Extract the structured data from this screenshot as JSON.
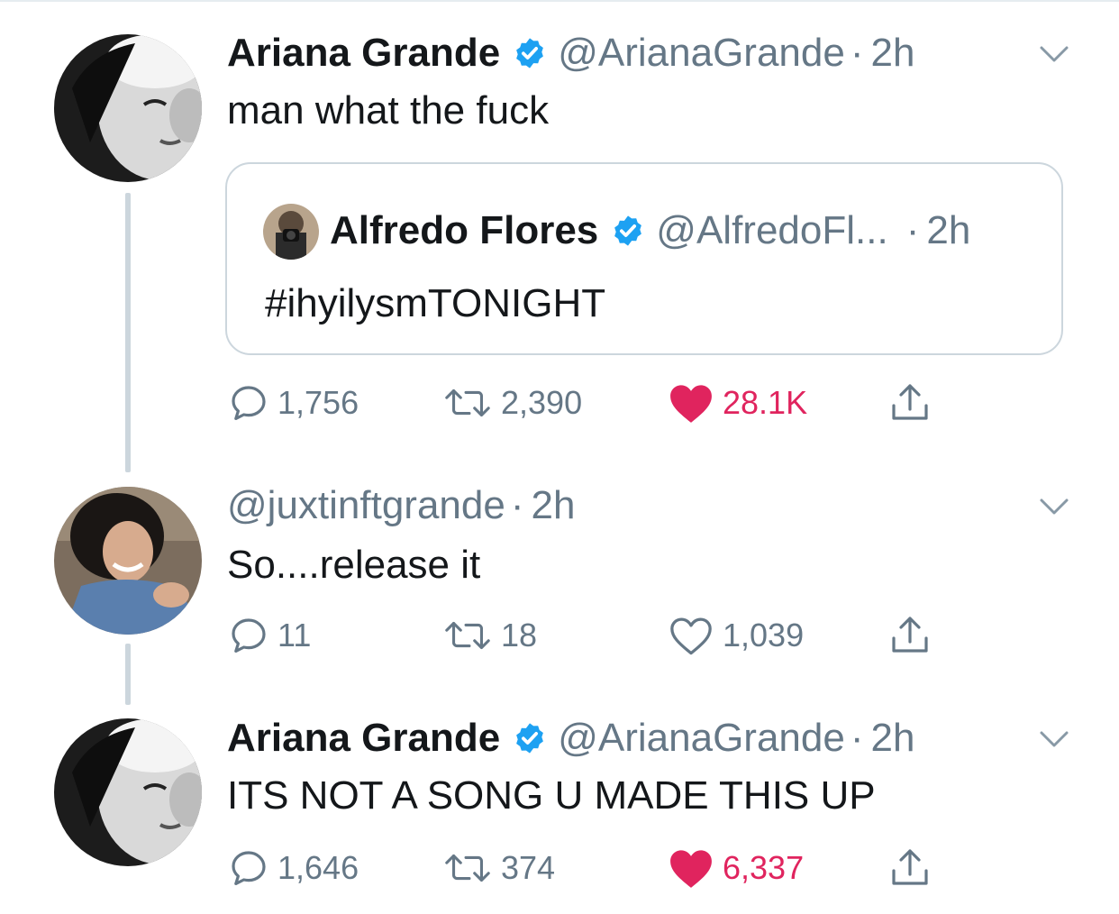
{
  "tweets": [
    {
      "name": "Ariana Grande",
      "handle": "@ArianaGrande",
      "dot": "·",
      "time": "2h",
      "text": "man what the fuck",
      "verified": true,
      "replies": "1,756",
      "retweets": "2,390",
      "likes": "28.1K",
      "liked": true
    },
    {
      "handle": "@juxtinftgrande",
      "dot": "·",
      "time": "2h",
      "text": "So....release it",
      "replies": "11",
      "retweets": "18",
      "likes": "1,039",
      "liked": false
    },
    {
      "name": "Ariana Grande",
      "handle": "@ArianaGrande",
      "dot": "·",
      "time": "2h",
      "text": "ITS NOT A SONG U MADE THIS UP",
      "verified": true,
      "replies": "1,646",
      "retweets": "374",
      "likes": "6,337",
      "liked": true
    }
  ],
  "quote": {
    "name": "Alfredo Flores",
    "handle": "@AlfredoFl...",
    "dot": "·",
    "time": "2h",
    "text": "#ihyilysmTONIGHT"
  },
  "colors": {
    "verified": "#1da1f2",
    "like_active": "#e0245e",
    "meta_gray": "#657786",
    "border": "#ccd6dd"
  },
  "icons": [
    "reply-icon",
    "retweet-icon",
    "heart-icon",
    "share-icon",
    "verified-badge-icon",
    "chevron-down-icon"
  ]
}
